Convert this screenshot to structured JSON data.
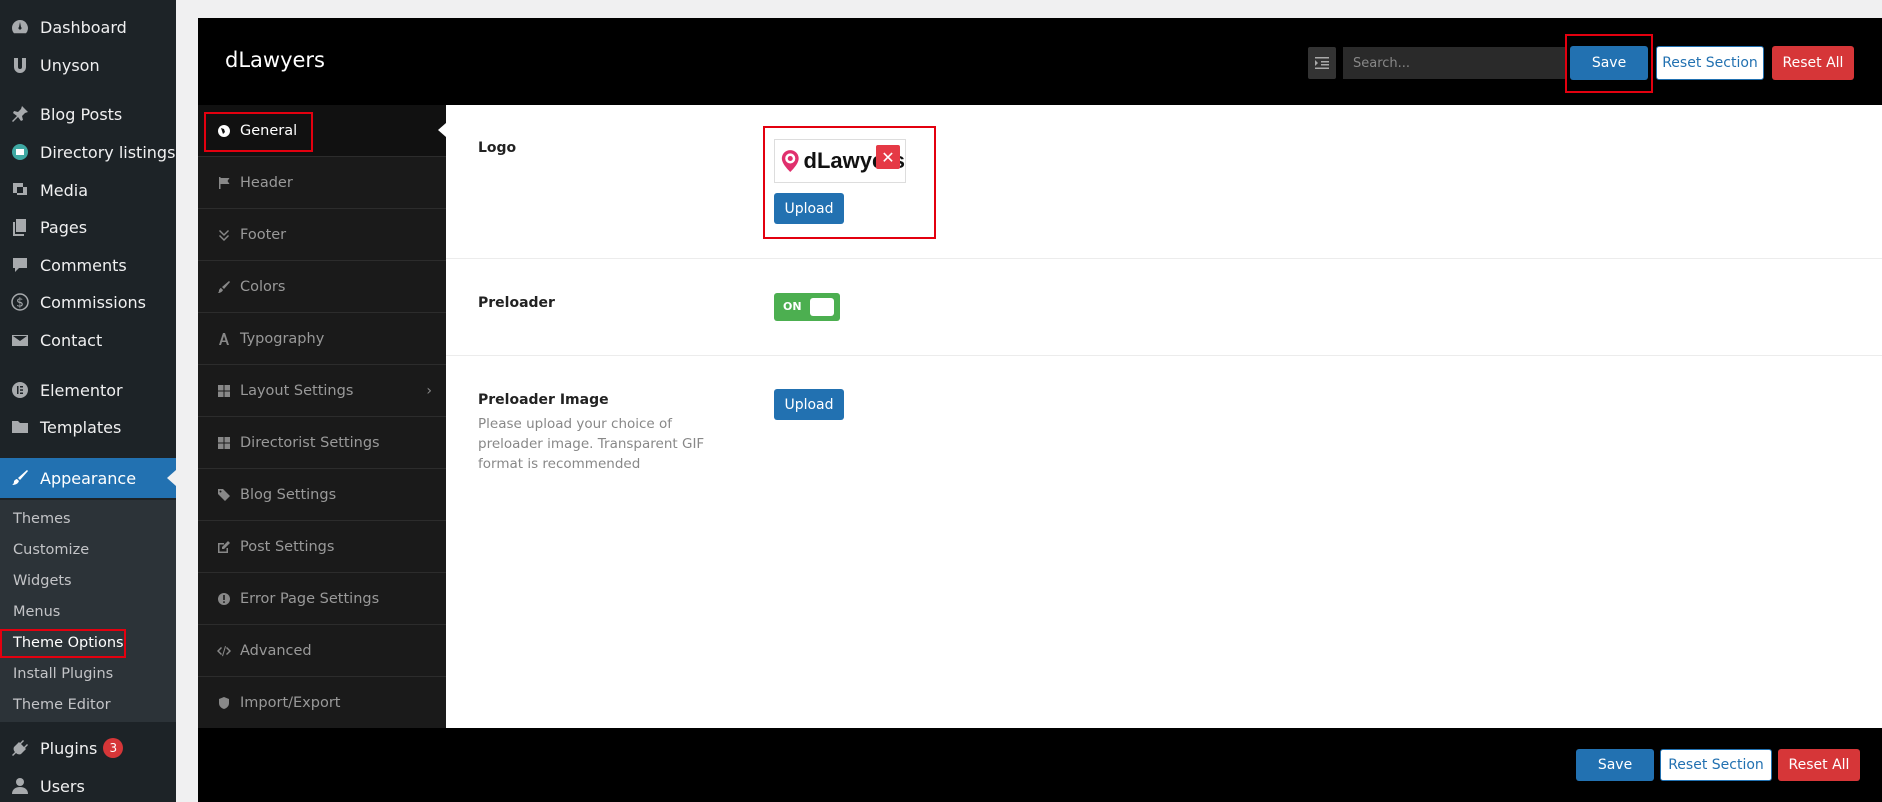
{
  "wp_menu": {
    "items": [
      {
        "label": "Dashboard",
        "icon": "dashboard-icon"
      },
      {
        "label": "Unyson",
        "icon": "unyson-icon"
      },
      {
        "label": "Blog Posts",
        "icon": "pin-icon"
      },
      {
        "label": "Directory listings",
        "icon": "directory-icon"
      },
      {
        "label": "Media",
        "icon": "media-icon"
      },
      {
        "label": "Pages",
        "icon": "pages-icon"
      },
      {
        "label": "Comments",
        "icon": "comments-icon"
      },
      {
        "label": "Commissions",
        "icon": "dollar-icon"
      },
      {
        "label": "Contact",
        "icon": "mail-icon"
      },
      {
        "label": "Elementor",
        "icon": "elementor-icon"
      },
      {
        "label": "Templates",
        "icon": "folder-icon"
      },
      {
        "label": "Appearance",
        "icon": "brush-icon"
      }
    ],
    "submenu": [
      "Themes",
      "Customize",
      "Widgets",
      "Menus",
      "Theme Options",
      "Install Plugins",
      "Theme Editor"
    ],
    "plugins_label": "Plugins",
    "plugins_badge": "3",
    "users_label": "Users"
  },
  "panel": {
    "brand": "dLawyers",
    "search_placeholder": "Search...",
    "save_label": "Save",
    "reset_section_label": "Reset Section",
    "reset_all_label": "Reset All"
  },
  "tabs": [
    {
      "label": "General",
      "icon": "globe-icon"
    },
    {
      "label": "Header",
      "icon": "flag-icon"
    },
    {
      "label": "Footer",
      "icon": "double-chevron-down-icon"
    },
    {
      "label": "Colors",
      "icon": "paintbrush-icon"
    },
    {
      "label": "Typography",
      "icon": "font-icon"
    },
    {
      "label": "Layout Settings",
      "icon": "grid-icon"
    },
    {
      "label": "Directorist Settings",
      "icon": "grid-icon"
    },
    {
      "label": "Blog Settings",
      "icon": "tags-icon"
    },
    {
      "label": "Post Settings",
      "icon": "edit-icon"
    },
    {
      "label": "Error Page Settings",
      "icon": "exclamation-icon"
    },
    {
      "label": "Advanced",
      "icon": "code-icon"
    },
    {
      "label": "Import/Export",
      "icon": "shield-icon"
    }
  ],
  "fields": {
    "logo_label": "Logo",
    "logo_preview_text": "dLawyers",
    "upload_label": "Upload",
    "preloader_label": "Preloader",
    "preloader_state": "ON",
    "preloader_image_label": "Preloader Image",
    "preloader_image_desc": "Please upload your choice of preloader image. Transparent GIF format is recommended"
  },
  "colors": {
    "accent": "#2271b1",
    "danger": "#d63638",
    "success": "#4caf50",
    "highlight_box": "#e3000f"
  }
}
